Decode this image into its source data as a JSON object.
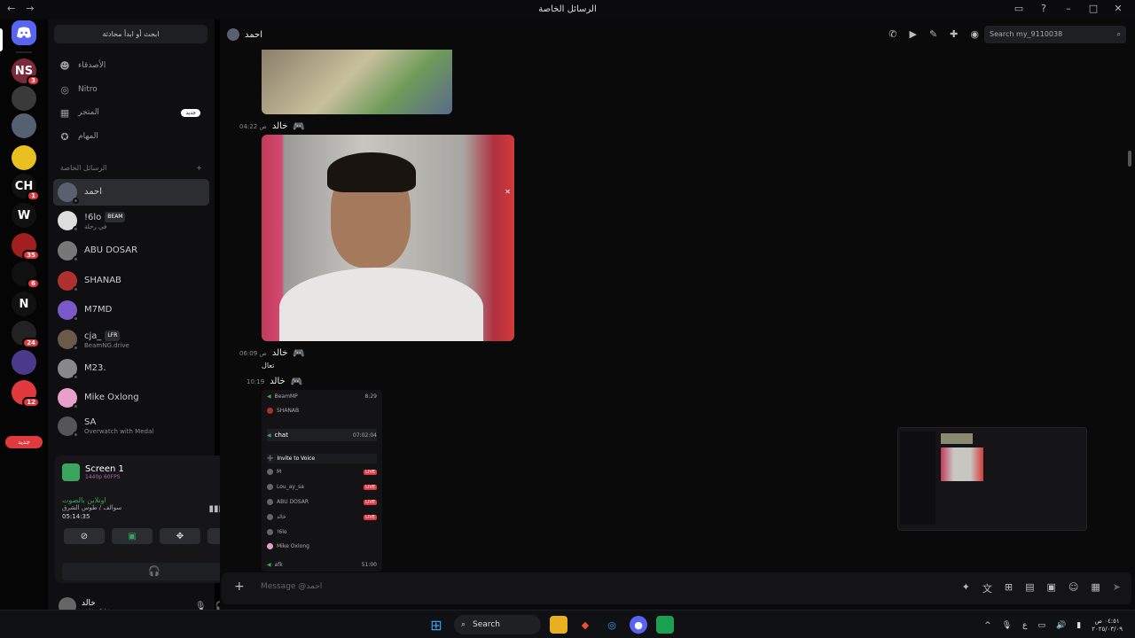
{
  "titlebar": {
    "title": "الرسائل الخاصة",
    "back": "←",
    "forward": "→"
  },
  "servers": [
    {
      "label": "NS",
      "badge": "3",
      "color": "#7a2a3a"
    },
    {
      "label": "",
      "badge": "",
      "color": "#3a3a3a"
    },
    {
      "label": "",
      "badge": "",
      "color": "#556070"
    },
    {
      "label": "",
      "badge": "",
      "color": "#e8c020"
    },
    {
      "label": "CH",
      "badge": "1",
      "color": "#111"
    },
    {
      "label": "W",
      "badge": "",
      "color": "#111"
    },
    {
      "label": "",
      "badge": "35",
      "color": "#a02020"
    },
    {
      "label": "",
      "badge": "6",
      "color": "#111"
    },
    {
      "label": "N",
      "badge": "",
      "color": "#111"
    },
    {
      "label": "",
      "badge": "24",
      "color": "#222"
    },
    {
      "label": "",
      "badge": "",
      "color": "#4a3a8a"
    },
    {
      "label": "",
      "badge": "12",
      "color": "#e03a3e"
    }
  ],
  "servers_new": "جديد",
  "sidebar": {
    "search_label": "ابحث أو ابدأ محادثة",
    "nav": [
      {
        "icon": "friends-icon",
        "glyph": "☻",
        "label": "الأصدقاء"
      },
      {
        "icon": "nitro-icon",
        "glyph": "◎",
        "label": "Nitro"
      },
      {
        "icon": "shop-icon",
        "glyph": "▦",
        "label": "المتجر",
        "badge": "جديد"
      },
      {
        "icon": "quests-icon",
        "glyph": "✪",
        "label": "المهام"
      }
    ],
    "dm_header": "الرسائل الخاصة",
    "dm_add": "+",
    "dms": [
      {
        "name": "احمد",
        "sub": "",
        "tag": "",
        "color": "#5a6070"
      },
      {
        "name": "!6lo",
        "sub": "في رحلة",
        "tag": "BEAM",
        "color": "#ddd"
      },
      {
        "name": "ABU DOSAR",
        "sub": "",
        "tag": "",
        "color": "#777"
      },
      {
        "name": "SHANAB",
        "sub": "",
        "tag": "",
        "color": "#b03030"
      },
      {
        "name": "M7MD",
        "sub": "",
        "tag": "",
        "color": "#7a5ac8"
      },
      {
        "name": "cja_",
        "sub": "BeamNG.drive",
        "tag": "LFR",
        "color": "#6a5a4a"
      },
      {
        "name": "M23.",
        "sub": "",
        "tag": "",
        "color": "#888"
      },
      {
        "name": "Mike Oxlong",
        "sub": "",
        "tag": "",
        "color": "#e8a0c8"
      },
      {
        "name": "SA",
        "sub": "Overwatch with Medal",
        "tag": "",
        "color": "#555"
      }
    ]
  },
  "voice": {
    "screen_title": "Screen 1",
    "screen_sub": "1440p 60FPS",
    "connected": "اونلاين بالصوت",
    "channel": "سوالف / طوس الشرق",
    "timer": "05:14:35",
    "headset_glyph": "🎧"
  },
  "user": {
    "name": "خالد",
    "status": "مشاركة شاشة"
  },
  "chat": {
    "title": "احمد",
    "search_placeholder": "Search my_9110038",
    "messages": [
      {
        "time": "04:22 ص",
        "author": "خالد"
      },
      {
        "time": "06:09 ص",
        "author": "خالد",
        "text": "تعال"
      },
      {
        "time": "10:19",
        "author": "خالد"
      }
    ],
    "mini": {
      "channel1": "BeamMP",
      "user1": "SHANAB",
      "channel2": "chat",
      "invite": "Invite to Voice",
      "live": "LIVE",
      "rows": [
        "M",
        "Lou_ay_sa",
        "ABU DOSAR",
        "خالد",
        "!6lo",
        "Mike Oxlong"
      ],
      "bottom": "afk",
      "time1": "8:29",
      "time2": "07:02:04",
      "time3": "51:00"
    },
    "composer_placeholder": "Message @احمد"
  },
  "taskbar": {
    "search": "Search",
    "lang": "ع",
    "time": "٠٤:٥١ ص",
    "date": "٢٠٢٥/٠٣/٠٩"
  },
  "colors": {
    "accent": "#5865f2",
    "green": "#3ba55d",
    "red": "#e03a3e"
  }
}
